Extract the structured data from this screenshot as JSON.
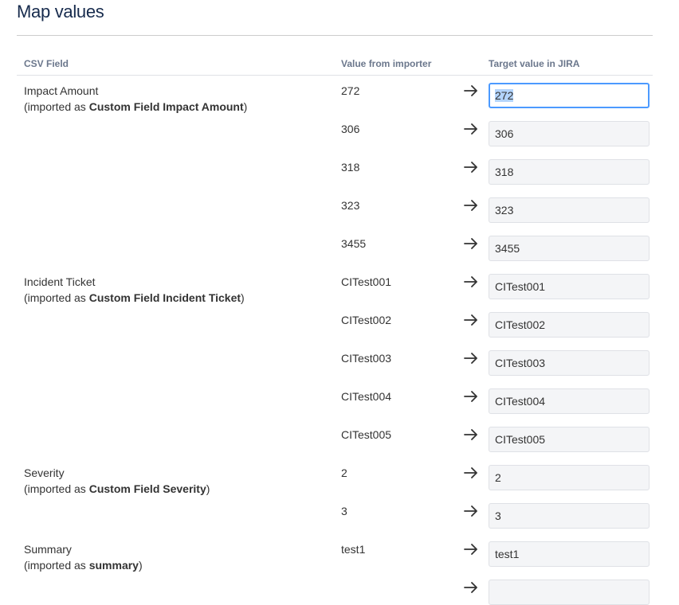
{
  "page": {
    "title": "Map values"
  },
  "table": {
    "headers": {
      "csv_field": "CSV Field",
      "value_from_importer": "Value from importer",
      "target_value": "Target value in JIRA"
    },
    "fields": [
      {
        "name": "Impact Amount",
        "imported_prefix": "(imported as ",
        "imported_as": "Custom Field Impact Amount",
        "imported_suffix": ")"
      },
      {
        "name": "Incident Ticket",
        "imported_prefix": "(imported as ",
        "imported_as": "Custom Field Incident Ticket",
        "imported_suffix": ")"
      },
      {
        "name": "Severity",
        "imported_prefix": "(imported as ",
        "imported_as": "Custom Field Severity",
        "imported_suffix": ")"
      },
      {
        "name": "Summary",
        "imported_prefix": "(imported as ",
        "imported_as": "summary",
        "imported_suffix": ")"
      }
    ],
    "rows": [
      {
        "source": "272",
        "target": "272"
      },
      {
        "source": "306",
        "target": "306"
      },
      {
        "source": "318",
        "target": "318"
      },
      {
        "source": "323",
        "target": "323"
      },
      {
        "source": "3455",
        "target": "3455"
      },
      {
        "source": "CITest001",
        "target": "CITest001"
      },
      {
        "source": "CITest002",
        "target": "CITest002"
      },
      {
        "source": "CITest003",
        "target": "CITest003"
      },
      {
        "source": "CITest004",
        "target": "CITest004"
      },
      {
        "source": "CITest005",
        "target": "CITest005"
      },
      {
        "source": "2",
        "target": "2"
      },
      {
        "source": "3",
        "target": "3"
      },
      {
        "source": "test1",
        "target": "test1"
      },
      {
        "source": "",
        "target": ""
      }
    ],
    "arrow_icon": "arrow-right-icon"
  },
  "colors": {
    "title": "#172b4d",
    "header_text": "#6b778c",
    "input_bg": "#f4f5f7",
    "focus_border": "#4c9aff"
  }
}
